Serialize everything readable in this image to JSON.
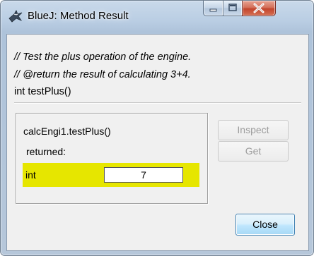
{
  "window": {
    "title": "BlueJ:  Method Result",
    "icon": "bluej-bird-icon",
    "caption_buttons": [
      "minimize",
      "maximize",
      "close"
    ]
  },
  "method": {
    "comment_line1": "// Test the plus operation of the engine.",
    "comment_line2": "// @return the result of calculating 3+4.",
    "signature": "int testPlus()"
  },
  "result": {
    "expression": "calcEngi1.testPlus()",
    "returned_label": "returned:",
    "type": "int",
    "value": "7"
  },
  "buttons": {
    "inspect": "Inspect",
    "get": "Get",
    "close": "Close"
  },
  "colors": {
    "highlight": "#e6e600",
    "close_button_border": "#3c7fb1"
  }
}
